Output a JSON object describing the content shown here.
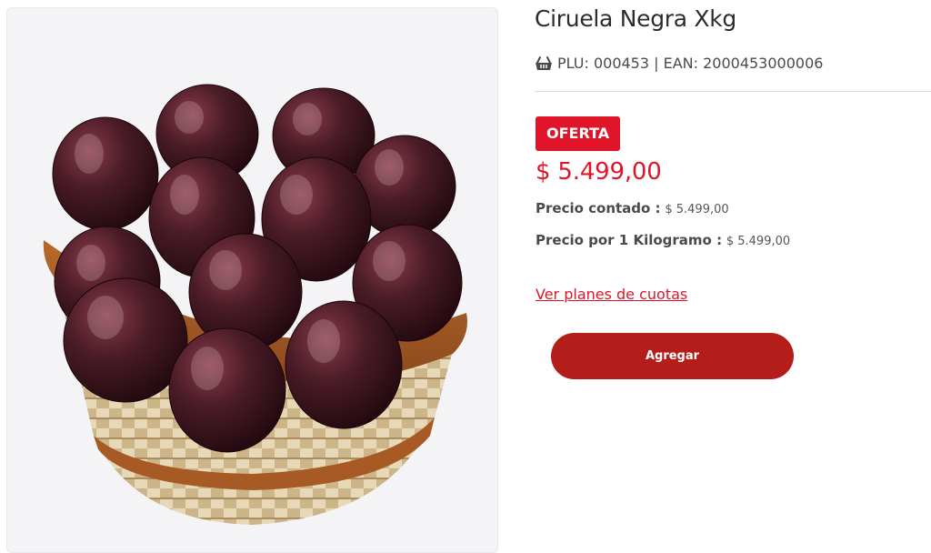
{
  "product": {
    "image_alt": "Ciruelas negras en canasta",
    "title": "Ciruela Negra Xkg",
    "codes_icon": "basket-icon",
    "codes_text": "PLU: 000453 | EAN: 2000453000006",
    "badge": "OFERTA",
    "price": "$ 5.499,00",
    "cash_price_label": "Precio contado :",
    "cash_price_value": "$ 5.499,00",
    "unit_price_label": "Precio por 1 Kilogramo :",
    "unit_price_value": "$ 5.499,00",
    "installments_link": "Ver planes de cuotas",
    "add_button": "Agregar"
  },
  "colors": {
    "accent": "#e0152a",
    "button": "#b31e1a"
  }
}
